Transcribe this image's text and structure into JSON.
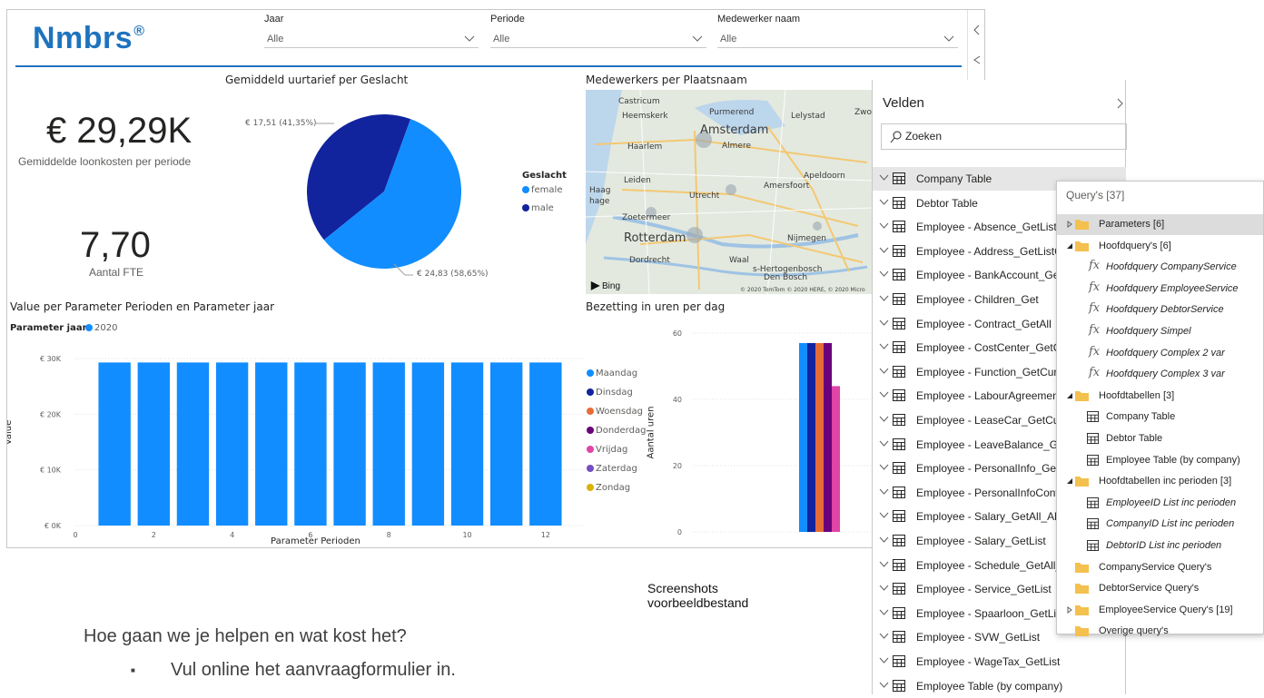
{
  "logo": {
    "text": "Nmbrs",
    "mark": "®"
  },
  "slicers": [
    {
      "label": "Jaar",
      "value": "Alle"
    },
    {
      "label": "Periode",
      "value": "Alle"
    },
    {
      "label": "Medewerker naam",
      "value": "Alle"
    }
  ],
  "kpis": [
    {
      "value": "€ 29,29K",
      "label": "Gemiddelde loonkosten per periode"
    },
    {
      "value": "7,70",
      "label": "Aantal FTE"
    }
  ],
  "pie_chart": {
    "title": "Gemiddeld uurtarief per Geslacht",
    "legend_title": "Geslacht",
    "legend": [
      "female",
      "male"
    ],
    "label_male": "€ 17,51 (41,35%)",
    "label_female": "€ 24,83 (58,65%)"
  },
  "map": {
    "title": "Medewerkers per Plaatsnaam",
    "cities": [
      "Castricum",
      "Heemskerk",
      "Purmerend",
      "Lelystad",
      "Amsterdam",
      "Haarlem",
      "Almere",
      "Apeldoorn",
      "Amersfoort",
      "Leiden",
      "Haag",
      "hage",
      "Utrecht",
      "Zoetermeer",
      "Rotterdam",
      "Nijmegen",
      "Dordrecht",
      "Waal",
      "s-Hertogenbosch",
      "Den Bosch",
      "Zwo"
    ],
    "bing_label": "Bing",
    "copyright": "© 2020 TomTom © 2020 HERE, © 2020 Micro"
  },
  "bar_chart": {
    "title": "Value per Parameter Perioden en Parameter jaar",
    "legend_title": "Parameter jaar",
    "legend_item": "2020",
    "y_axis_title": "Value",
    "x_axis_title": "Parameter Perioden",
    "y_ticks": [
      "€ 30K",
      "€ 20K",
      "€ 10K",
      "€ 0K"
    ],
    "x_ticks": [
      "0",
      "2",
      "4",
      "6",
      "8",
      "10",
      "12"
    ]
  },
  "day_chart": {
    "title": "Bezetting in uren per dag",
    "y_axis_title": "Aantal uren",
    "y_ticks": [
      "60",
      "40",
      "20",
      "0"
    ],
    "legend": [
      {
        "name": "Maandag",
        "color": "#118dff"
      },
      {
        "name": "Dinsdag",
        "color": "#12239e"
      },
      {
        "name": "Woensdag",
        "color": "#e66c37"
      },
      {
        "name": "Donderdag",
        "color": "#6b007b"
      },
      {
        "name": "Vrijdag",
        "color": "#e044a7"
      },
      {
        "name": "Zaterdag",
        "color": "#744ec2"
      },
      {
        "name": "Zondag",
        "color": "#d9b300"
      }
    ]
  },
  "chart_data": [
    {
      "type": "pie",
      "title": "Gemiddeld uurtarief per Geslacht",
      "labels": [
        "female",
        "male"
      ],
      "values": [
        24.83,
        17.51
      ],
      "percent": [
        58.65,
        41.35
      ],
      "colors": [
        "#118dff",
        "#12239e"
      ]
    },
    {
      "type": "bar",
      "title": "Value per Parameter Perioden en Parameter jaar",
      "xlabel": "Parameter Perioden",
      "ylabel": "Value",
      "categories": [
        1,
        2,
        3,
        4,
        5,
        6,
        7,
        8,
        9,
        10,
        11,
        12
      ],
      "series": [
        {
          "name": "2020",
          "values": [
            29290,
            29290,
            29290,
            29290,
            29290,
            29290,
            29290,
            29290,
            29290,
            29290,
            29290,
            29290
          ]
        }
      ],
      "xlim": [
        0,
        13
      ],
      "ylim": [
        0,
        30000
      ],
      "color": "#118dff"
    },
    {
      "type": "bar",
      "title": "Bezetting in uren per dag",
      "ylabel": "Aantal uren",
      "series": [
        {
          "name": "Maandag",
          "values": [
            57
          ]
        },
        {
          "name": "Dinsdag",
          "values": [
            57
          ]
        },
        {
          "name": "Woensdag",
          "values": [
            57
          ]
        },
        {
          "name": "Donderdag",
          "values": [
            57
          ]
        },
        {
          "name": "Vrijdag",
          "values": [
            44
          ]
        }
      ],
      "ylim": [
        0,
        60
      ]
    }
  ],
  "velden": {
    "title": "Velden",
    "search_placeholder": "Zoeken",
    "items": [
      "Company Table",
      "Debtor Table",
      "Employee - Absence_GetList",
      "Employee - Address_GetListCu",
      "Employee - BankAccount_Get",
      "Employee - Children_Get",
      "Employee - Contract_GetAll",
      "Employee - CostCenter_GetCu",
      "Employee - Function_GetCurre",
      "Employee - LabourAgreement",
      "Employee - LeaseCar_GetCurr",
      "Employee - LeaveBalance_Get",
      "Employee - PersonalInfo_GetC",
      "Employee - PersonalInfoContr",
      "Employee - Salary_GetAll_AllE",
      "Employee - Salary_GetList",
      "Employee - Schedule_GetAll_A",
      "Employee - Service_GetList",
      "Employee - Spaarloon_GetList",
      "Employee - SVW_GetList",
      "Employee - WageTax_GetList",
      "Employee Table (by company)"
    ]
  },
  "queries": {
    "header": "Query's [37]",
    "rows": [
      {
        "label": "Parameters [6]",
        "kind": "folder",
        "expand": "closed"
      },
      {
        "label": "Hoofdquery's [6]",
        "kind": "folder",
        "expand": "open"
      },
      {
        "label": "Hoofdquery CompanyService",
        "kind": "fx"
      },
      {
        "label": "Hoofdquery EmployeeService",
        "kind": "fx"
      },
      {
        "label": "Hoofdquery DebtorService",
        "kind": "fx"
      },
      {
        "label": "Hoofdquery Simpel",
        "kind": "fx"
      },
      {
        "label": "Hoofdquery Complex 2 var",
        "kind": "fx"
      },
      {
        "label": "Hoofdquery Complex 3 var",
        "kind": "fx"
      },
      {
        "label": "Hoofdtabellen [3]",
        "kind": "folder",
        "expand": "open"
      },
      {
        "label": "Company Table",
        "kind": "table"
      },
      {
        "label": "Debtor Table",
        "kind": "table"
      },
      {
        "label": "Employee Table (by company)",
        "kind": "table"
      },
      {
        "label": "Hoofdtabellen inc perioden [3]",
        "kind": "folder",
        "expand": "open"
      },
      {
        "label": "EmployeeID List inc perioden",
        "kind": "table-italic"
      },
      {
        "label": "CompanyID List inc perioden",
        "kind": "table-italic"
      },
      {
        "label": "DebtorID List inc perioden",
        "kind": "table-italic"
      },
      {
        "label": "CompanyService Query's",
        "kind": "folder",
        "expand": "none"
      },
      {
        "label": "DebtorService Query's",
        "kind": "folder",
        "expand": "none"
      },
      {
        "label": "EmployeeService Query's [19]",
        "kind": "folder",
        "expand": "closed"
      },
      {
        "label": "Overige query's",
        "kind": "folder",
        "expand": "none"
      }
    ]
  },
  "slide": {
    "caption": "Screenshots voorbeeldbestand",
    "heading": "Hoe gaan we je helpen en wat kost het?",
    "bullet": "Vul online het aanvraagformulier in."
  }
}
